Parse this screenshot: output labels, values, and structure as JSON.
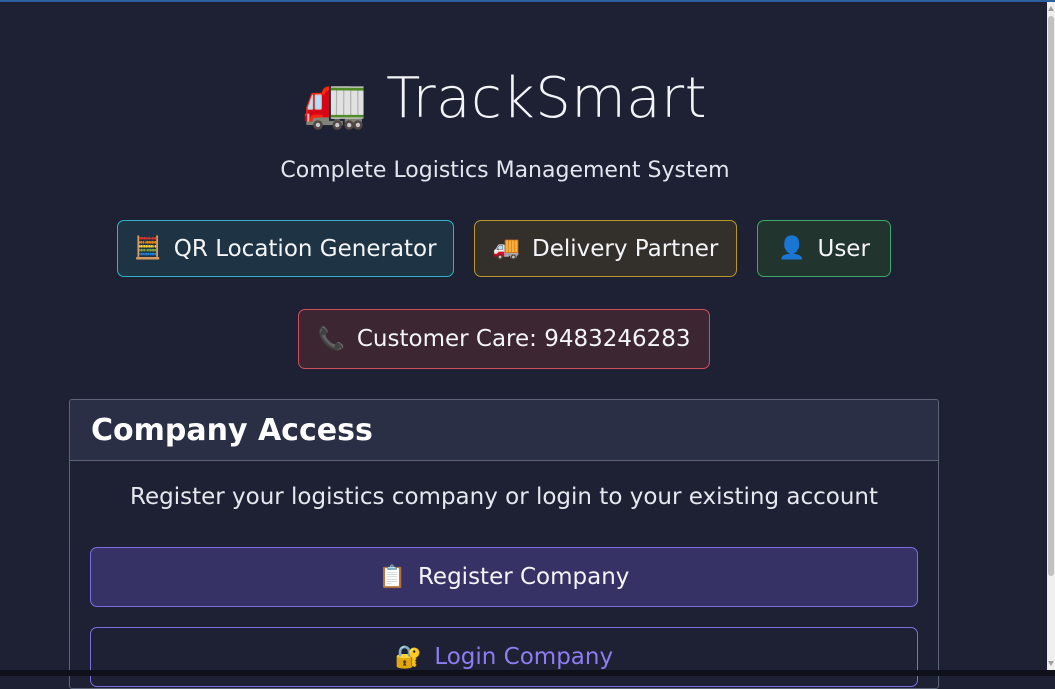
{
  "header": {
    "title_icon": "🚛",
    "title": "TrackSmart",
    "subtitle": "Complete Logistics Management System"
  },
  "nav": {
    "qr": {
      "icon": "🧮",
      "label": "QR Location Generator"
    },
    "delivery": {
      "icon": "🚚",
      "label": "Delivery Partner"
    },
    "user": {
      "icon": "👤",
      "label": "User"
    },
    "customer_care": {
      "icon": "📞",
      "label": "Customer Care: 9483246283"
    }
  },
  "company_access": {
    "heading": "Company Access",
    "description": "Register your logistics company or login to your existing account",
    "register": {
      "icon": "📋",
      "label": "Register Company"
    },
    "login": {
      "icon": "🔐",
      "label": "Login Company"
    }
  },
  "colors": {
    "background": "#1d2133",
    "accent_purple": "#7b6ee0",
    "qr_border": "#2fb4c7",
    "delivery_border": "#b9962a",
    "user_border": "#3ca86a",
    "care_border": "#d24d5e"
  }
}
